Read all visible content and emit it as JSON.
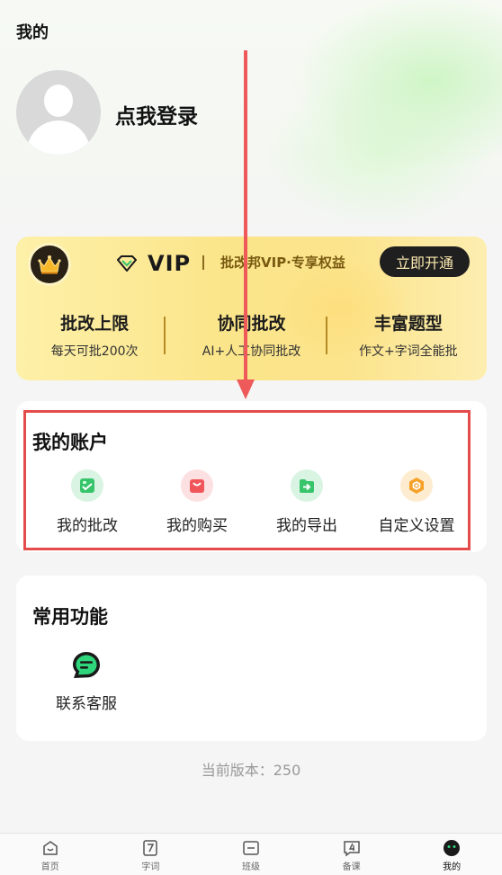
{
  "header": {
    "title": "我的"
  },
  "profile": {
    "login_text": "点我登录"
  },
  "vip": {
    "logo_text": "VIP",
    "slogan": "批改邦VIP·专享权益",
    "button_label": "立即开通",
    "benefits": [
      {
        "title": "批改上限",
        "desc": "每天可批200次"
      },
      {
        "title": "协同批改",
        "desc": "AI+人工协同批改"
      },
      {
        "title": "丰富题型",
        "desc": "作文+字词全能批"
      }
    ]
  },
  "account": {
    "title": "我的账户",
    "items": [
      {
        "label": "我的批改",
        "icon": "corrections-icon",
        "color": "#37c46b"
      },
      {
        "label": "我的购买",
        "icon": "shopping-bag-icon",
        "color": "#f0555a"
      },
      {
        "label": "我的导出",
        "icon": "export-folder-icon",
        "color": "#37c46b"
      },
      {
        "label": "自定义设置",
        "icon": "settings-hexagon-icon",
        "color": "#f5a12a"
      }
    ]
  },
  "common": {
    "title": "常用功能",
    "items": [
      {
        "label": "联系客服",
        "icon": "chat-bubble-icon"
      }
    ]
  },
  "version_text": "当前版本：250",
  "tabbar": {
    "tabs": [
      {
        "label": "首页",
        "icon": "home-icon"
      },
      {
        "label": "字词",
        "icon": "word-icon"
      },
      {
        "label": "班级",
        "icon": "class-icon"
      },
      {
        "label": "备课",
        "icon": "lesson-icon"
      },
      {
        "label": "我的",
        "icon": "profile-icon",
        "active": true
      }
    ]
  }
}
